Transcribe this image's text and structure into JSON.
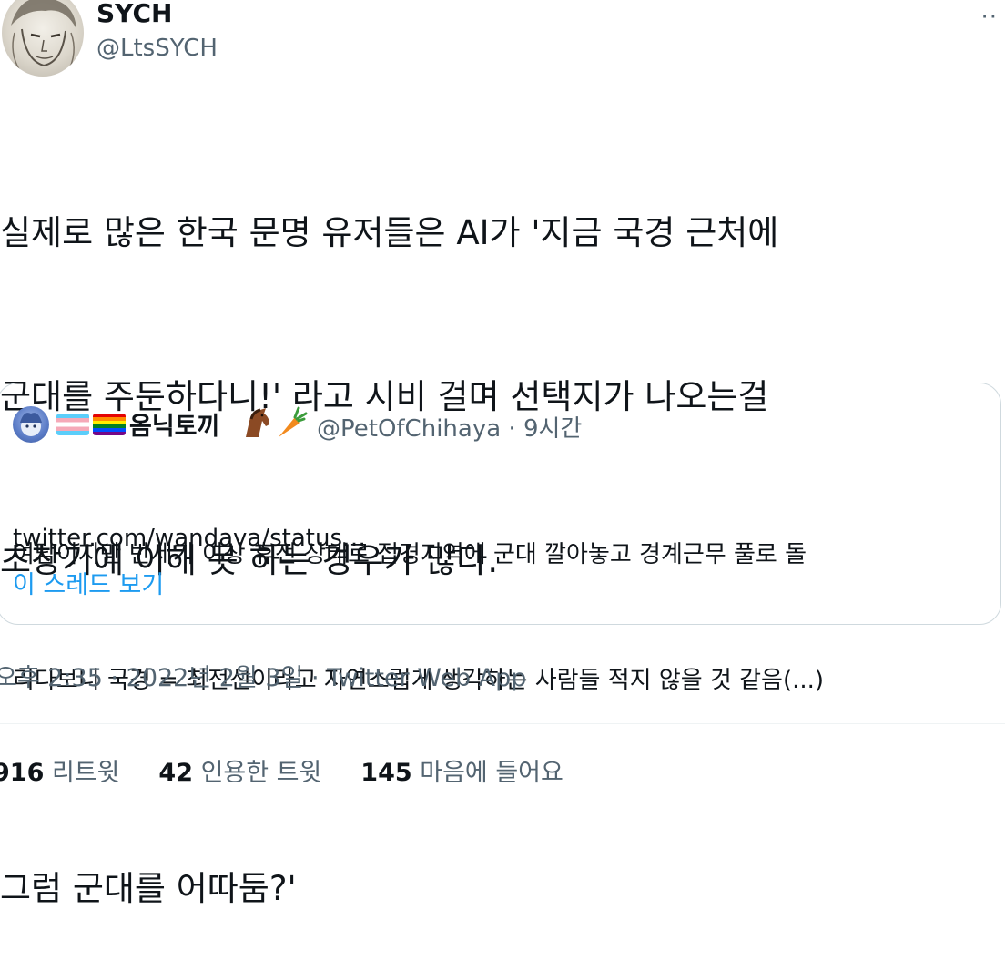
{
  "author": {
    "name": "SYCH",
    "handle": "@LtsSYCH"
  },
  "more_icon": "more-dots-icon",
  "tweet": {
    "lines": [
      "실제로 많은 한국 문명 유저들은 AI가 '지금 국경 근처에",
      "군대를 주둔하다니!' 라고 시비 걸며 선택지가 나오는걸",
      "초창기에 이해 못 하는 경우가 많다.",
      "",
      "그럼 군대를 어따둠?'"
    ]
  },
  "quote": {
    "name": "옴닉토끼",
    "emoji_icons": [
      "transgender-flag-icon",
      "rainbow-flag-icon",
      "horse-icon",
      "carrot-icon"
    ],
    "handle": "@PetOfChihaya",
    "separator": " · ",
    "time": "9시간",
    "text_lines": [
      "여담이지만 반세기 이상 휴전 상태로 접경지역에 군대 깔아놓고 경계근무 풀로 돌",
      "리다보니 국경 = 최전선이라고 자연스럽게 생각하는 사람들 적지 않을 것 같음(...)"
    ],
    "link": "twitter.com/wandava/status…",
    "show_thread": "이 스레드 보기"
  },
  "timestamp": "오후 2:35 · 2022년 2월 3일 · Twitter Web App",
  "stats": {
    "retweets_count": "916",
    "retweets_label": " 리트윗",
    "quotes_count": "42",
    "quotes_label": " 인용한 트윗",
    "likes_count": "145",
    "likes_label": " 마음에 들어요"
  },
  "colors": {
    "text": "#0f1419",
    "secondary": "#536471",
    "link": "#1d9bf0",
    "border": "#cfd9de"
  }
}
